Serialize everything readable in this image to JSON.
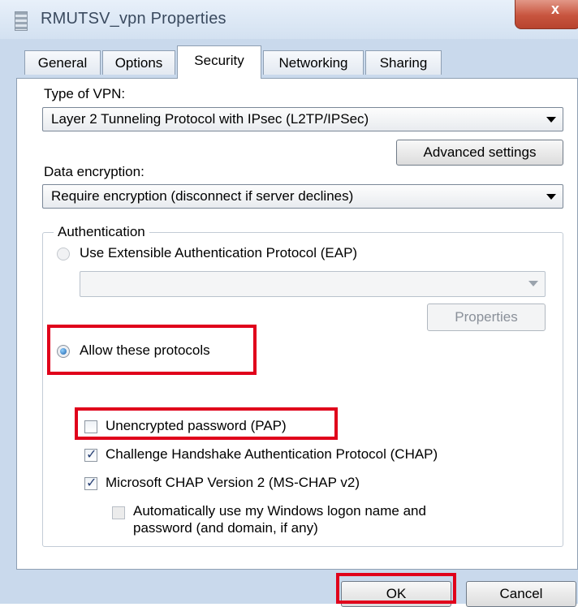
{
  "window": {
    "title": "RMUTSV_vpn Properties",
    "close_glyph": "x"
  },
  "tabs": [
    {
      "label": "General",
      "active": false
    },
    {
      "label": "Options",
      "active": false
    },
    {
      "label": "Security",
      "active": true
    },
    {
      "label": "Networking",
      "active": false
    },
    {
      "label": "Sharing",
      "active": false
    }
  ],
  "security": {
    "vpn_type_label": "Type of VPN:",
    "vpn_type_value": "Layer 2 Tunneling Protocol with IPsec (L2TP/IPSec)",
    "advanced_settings_label": "Advanced settings",
    "encryption_label": "Data encryption:",
    "encryption_value": "Require encryption (disconnect if server declines)",
    "authentication": {
      "group_label": "Authentication",
      "eap_label": "Use Extensible Authentication Protocol (EAP)",
      "eap_selected": false,
      "eap_method_value": "",
      "properties_label": "Properties",
      "allow_protocols_label": "Allow these protocols",
      "allow_protocols_selected": true,
      "protocols": [
        {
          "label": "Unencrypted password (PAP)",
          "checked": false
        },
        {
          "label": "Challenge Handshake Authentication Protocol (CHAP)",
          "checked": true
        },
        {
          "label": "Microsoft CHAP Version 2 (MS-CHAP v2)",
          "checked": true
        }
      ],
      "auto_logon_label_line1": "Automatically use my Windows logon name and",
      "auto_logon_label_line2": "password (and domain, if any)",
      "auto_logon_checked": false
    }
  },
  "footer": {
    "ok_label": "OK",
    "cancel_label": "Cancel"
  },
  "colors": {
    "highlight": "#e0001b",
    "accent": "#1c5fa8"
  }
}
